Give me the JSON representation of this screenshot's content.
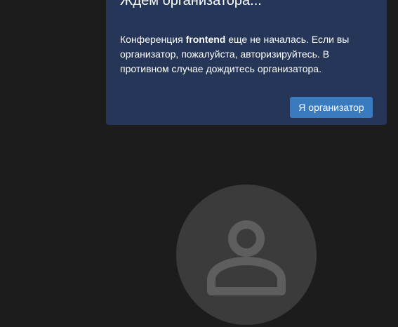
{
  "dialog": {
    "title": "Ждем организатора...",
    "body": {
      "prefix": "Конференция ",
      "conference_name": "frontend",
      "suffix": " еще не началась. Если вы организатор, пожалуйста, авторизируйтесь. В противном случае дождитесь организатора."
    },
    "moderator_button_label": "Я организатор"
  },
  "avatar": {
    "icon": "user-icon"
  },
  "colors": {
    "background": "#1c1c1c",
    "dialog_background": "#253658",
    "button": "#3a7bc0",
    "avatar_circle": "#3b3b3b",
    "avatar_icon": "#5e5e5e"
  }
}
